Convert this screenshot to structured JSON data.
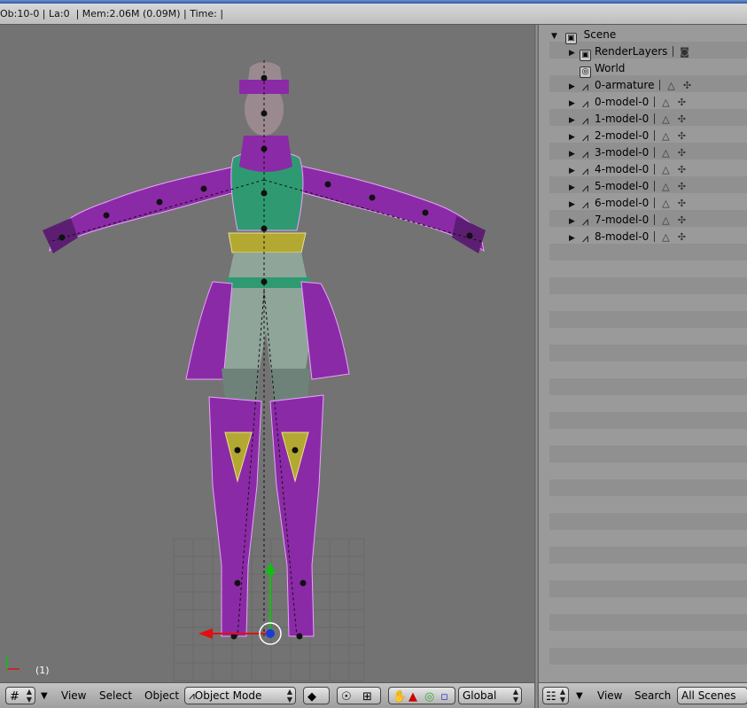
{
  "info_bar": {
    "text": "Ob:10-0 | La:0  | Mem:2.06M (0.09M) | Time: |"
  },
  "viewport": {
    "frame_label": "(1)"
  },
  "outliner": {
    "root": "Scene",
    "items": [
      {
        "label": "RenderLayers",
        "icon": "render-layers-icon",
        "expandable": true
      },
      {
        "label": "World",
        "icon": "world-icon",
        "expandable": false
      },
      {
        "label": "0-armature",
        "icon": "armature-icon",
        "expandable": true
      },
      {
        "label": "0-model-0",
        "icon": "armature-icon",
        "expandable": true
      },
      {
        "label": "1-model-0",
        "icon": "armature-icon",
        "expandable": true
      },
      {
        "label": "2-model-0",
        "icon": "armature-icon",
        "expandable": true
      },
      {
        "label": "3-model-0",
        "icon": "armature-icon",
        "expandable": true
      },
      {
        "label": "4-model-0",
        "icon": "armature-icon",
        "expandable": true
      },
      {
        "label": "5-model-0",
        "icon": "armature-icon",
        "expandable": true
      },
      {
        "label": "6-model-0",
        "icon": "armature-icon",
        "expandable": true
      },
      {
        "label": "7-model-0",
        "icon": "armature-icon",
        "expandable": true
      },
      {
        "label": "8-model-0",
        "icon": "armature-icon",
        "expandable": true
      }
    ]
  },
  "viewport_header": {
    "menus": {
      "view": "View",
      "select": "Select",
      "object": "Object"
    },
    "mode": "Object Mode",
    "orientation": "Global"
  },
  "outliner_header": {
    "menus": {
      "view": "View",
      "search": "Search"
    },
    "scope": "All Scenes"
  },
  "colors": {
    "viewport_bg": "#737373",
    "outfit_purple": "#8b2aa6",
    "outfit_green": "#2f9a72",
    "accent_yellow": "#b3a832",
    "x_axis": "#e01010",
    "y_axis": "#10c010"
  }
}
